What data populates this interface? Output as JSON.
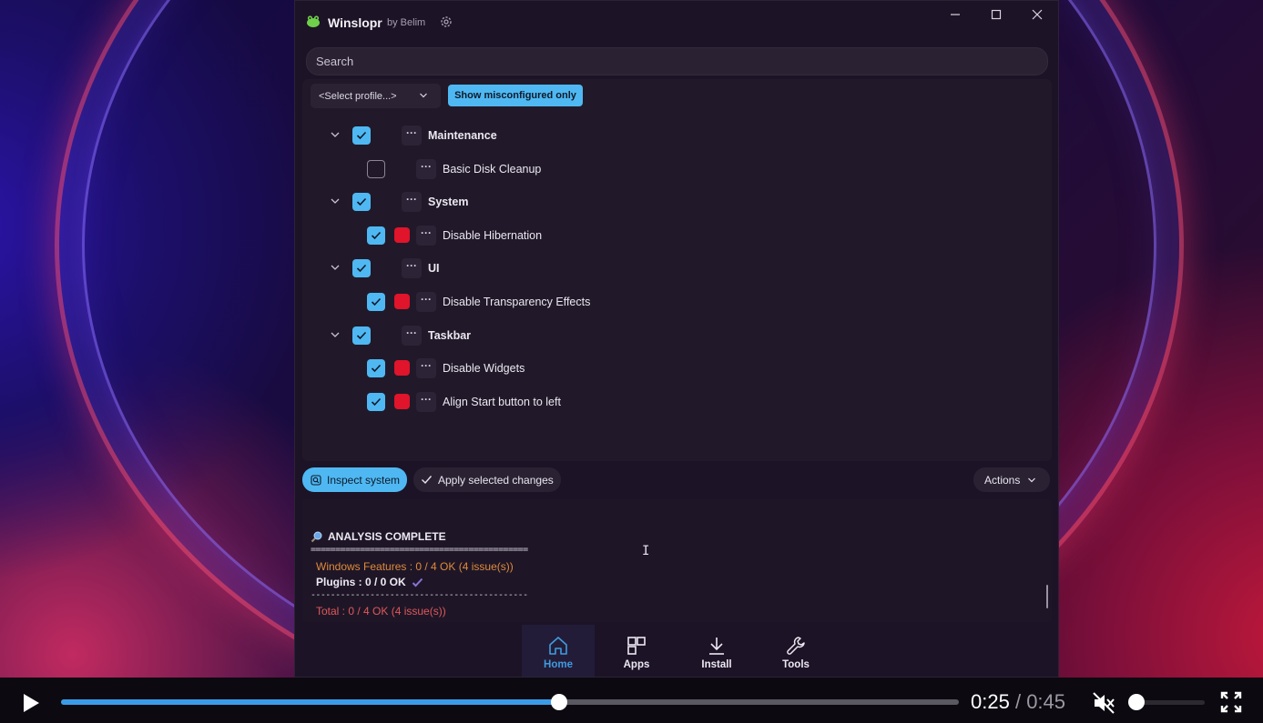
{
  "app": {
    "name": "Winslopr",
    "by": "by Belim"
  },
  "search": {
    "placeholder": "Search"
  },
  "filters": {
    "profile_select": "<Select profile...>",
    "misconfigured_button": "Show misconfigured only"
  },
  "tree": [
    {
      "label": "Maintenance",
      "level": 1,
      "checked": true,
      "issue": false,
      "expanded": true
    },
    {
      "label": "Basic Disk Cleanup",
      "level": 2,
      "checked": false,
      "issue": false
    },
    {
      "label": "System",
      "level": 1,
      "checked": true,
      "issue": false,
      "expanded": true
    },
    {
      "label": "Disable Hibernation",
      "level": 2,
      "checked": true,
      "issue": true
    },
    {
      "label": "UI",
      "level": 1,
      "checked": true,
      "issue": false,
      "expanded": true
    },
    {
      "label": "Disable Transparency Effects",
      "level": 2,
      "checked": true,
      "issue": true
    },
    {
      "label": "Taskbar",
      "level": 1,
      "checked": true,
      "issue": false,
      "expanded": true
    },
    {
      "label": "Disable Widgets",
      "level": 2,
      "checked": true,
      "issue": true
    },
    {
      "label": "Align Start button to left",
      "level": 2,
      "checked": true,
      "issue": true
    }
  ],
  "more_glyph": "···",
  "actions": {
    "inspect": "Inspect system",
    "apply": "Apply selected changes",
    "menu": "Actions"
  },
  "console": {
    "heading": "ANALYSIS COMPLETE",
    "separator": "============================================",
    "windows_features": "Windows Features : 0 / 4 OK  (4 issue(s))",
    "plugins": "Plugins : 0 / 0 OK",
    "separator2": "--------------------------------------------",
    "total": "Total : 0 / 4 OK  (4 issue(s))"
  },
  "nav": {
    "home": "Home",
    "apps": "Apps",
    "install": "Install",
    "tools": "Tools"
  },
  "player": {
    "current_time": "0:25",
    "duration": "0:45",
    "progress": 0.555,
    "volume": 0.0
  },
  "colors": {
    "accent": "#4fb8f2",
    "issue_red": "#e0142a",
    "warning_orange": "#e08a3a",
    "error_red": "#e0585a",
    "nav_active": "#3f9be0"
  },
  "icons": {
    "logo": "frog-logo-icon",
    "settings": "gear-icon",
    "minimize": "minimize-icon",
    "maximize": "maximize-icon",
    "close": "close-icon",
    "expander": "chevron-down-icon",
    "inspect": "inspect-icon",
    "apply": "checkmark-icon",
    "home": "home-icon",
    "apps": "apps-grid-icon",
    "install": "download-icon",
    "tools": "wrench-icon",
    "play": "play-icon",
    "mute": "mute-icon",
    "fullscreen": "fullscreen-icon"
  }
}
